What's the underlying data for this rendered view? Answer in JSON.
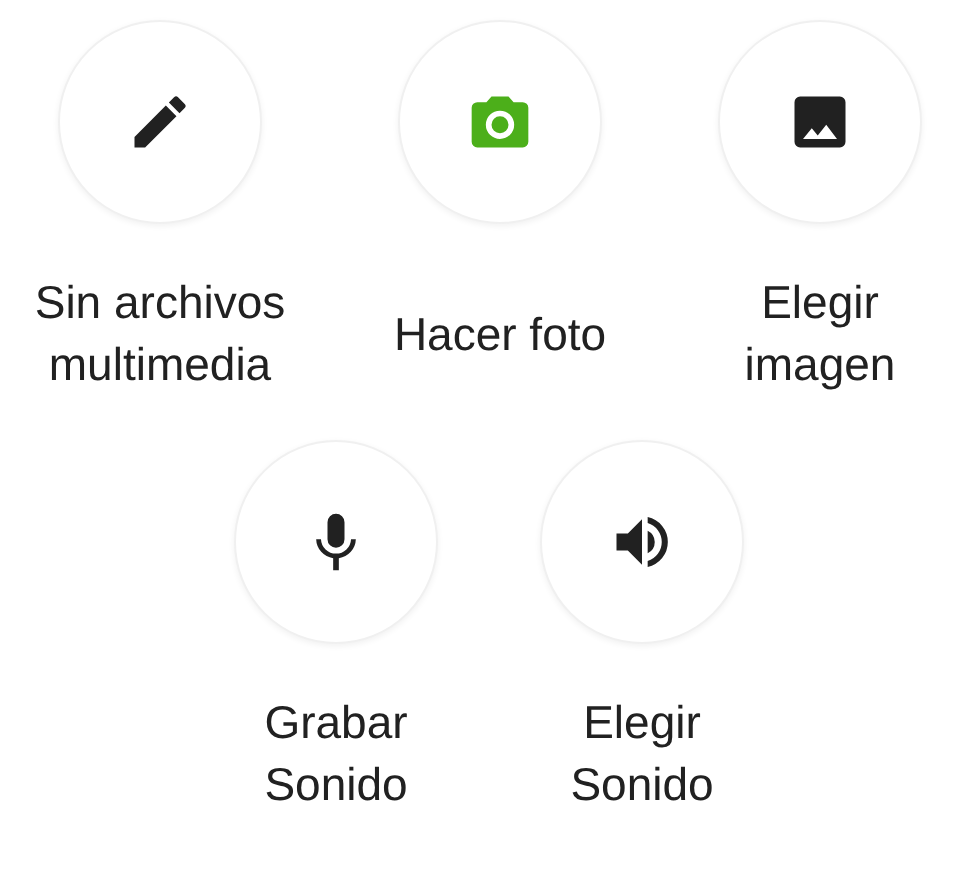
{
  "rows": [
    [
      {
        "label": "Sin archivos\nmultimedia",
        "selected": false
      },
      {
        "label": "Hacer foto",
        "selected": true
      },
      {
        "label": "Elegir\nimagen",
        "selected": false
      }
    ],
    [
      {
        "label": "Grabar\nSonido",
        "selected": false
      },
      {
        "label": "Elegir\nSonido",
        "selected": false
      }
    ]
  ]
}
